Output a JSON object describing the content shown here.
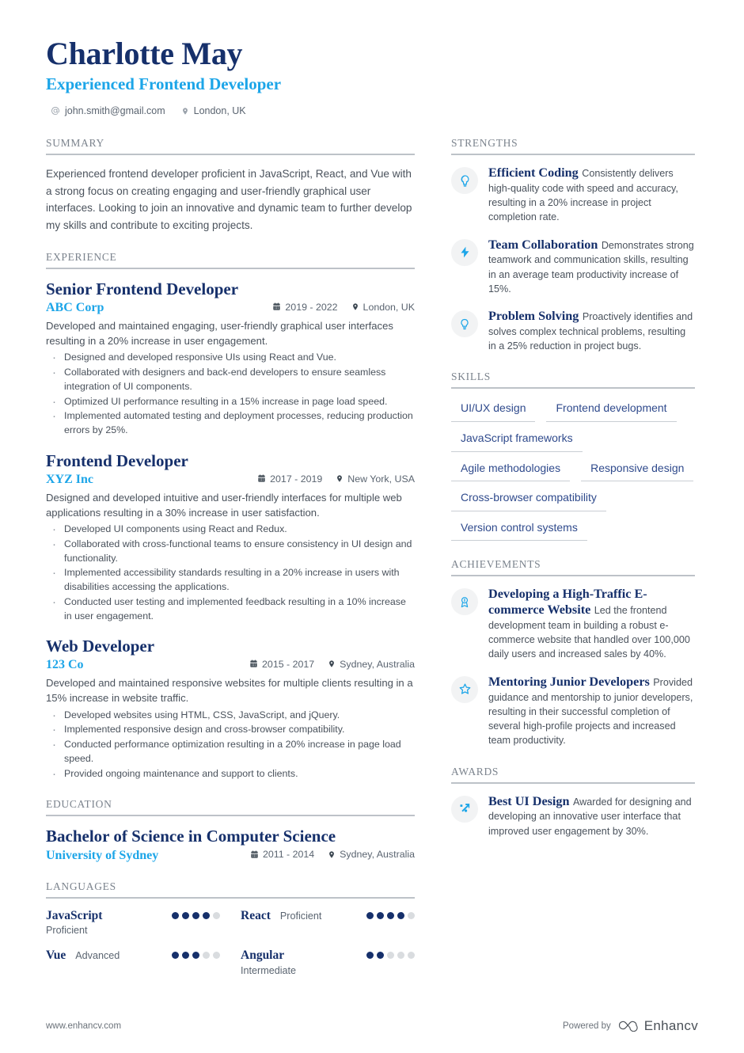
{
  "header": {
    "name": "Charlotte May",
    "title": "Experienced Frontend Developer",
    "email": "john.smith@gmail.com",
    "location": "London, UK",
    "email_icon": "at-icon",
    "location_icon": "map-pin-icon"
  },
  "colors": {
    "navy": "#16306b",
    "cyan": "#1ca5e8",
    "gray_heading": "#7b838d",
    "body": "#4a525c",
    "skill_text": "#2f4a8c"
  },
  "sections": {
    "summary": "SUMMARY",
    "experience": "EXPERIENCE",
    "education": "EDUCATION",
    "languages": "LANGUAGES",
    "strengths": "STRENGTHS",
    "skills": "SKILLS",
    "achievements": "ACHIEVEMENTS",
    "awards": "AWARDS"
  },
  "summary": {
    "text": "Experienced frontend developer proficient in JavaScript, React, and Vue with a strong focus on creating engaging and user-friendly graphical user interfaces. Looking to join an innovative and dynamic team to further develop my skills and contribute to exciting projects."
  },
  "experience": [
    {
      "title": "Senior Frontend Developer",
      "company": "ABC Corp",
      "dates": "2019 - 2022",
      "location": "London, UK",
      "description": "Developed and maintained engaging, user-friendly graphical user interfaces resulting in a 20% increase in user engagement.",
      "bullets": [
        "Designed and developed responsive UIs using React and Vue.",
        "Collaborated with designers and back-end developers to ensure seamless integration of UI components.",
        "Optimized UI performance resulting in a 15% increase in page load speed.",
        "Implemented automated testing and deployment processes, reducing production errors by 25%."
      ]
    },
    {
      "title": "Frontend Developer",
      "company": "XYZ Inc",
      "dates": "2017 - 2019",
      "location": "New York, USA",
      "description": "Designed and developed intuitive and user-friendly interfaces for multiple web applications resulting in a 30% increase in user satisfaction.",
      "bullets": [
        "Developed UI components using React and Redux.",
        "Collaborated with cross-functional teams to ensure consistency in UI design and functionality.",
        "Implemented accessibility standards resulting in a 20% increase in users with disabilities accessing the applications.",
        "Conducted user testing and implemented feedback resulting in a 10% increase in user engagement."
      ]
    },
    {
      "title": "Web Developer",
      "company": "123 Co",
      "dates": "2015 - 2017",
      "location": "Sydney, Australia",
      "description": "Developed and maintained responsive websites for multiple clients resulting in a 15% increase in website traffic.",
      "bullets": [
        "Developed websites using HTML, CSS, JavaScript, and jQuery.",
        "Implemented responsive design and cross-browser compatibility.",
        "Conducted performance optimization resulting in a 20% increase in page load speed.",
        "Provided ongoing maintenance and support to clients."
      ]
    }
  ],
  "education": [
    {
      "degree": "Bachelor of Science in Computer Science",
      "school": "University of Sydney",
      "dates": "2011 - 2014",
      "location": "Sydney, Australia"
    }
  ],
  "languages": [
    {
      "name": "JavaScript",
      "level": "Proficient",
      "rating": 4,
      "max": 5,
      "level_inline": false
    },
    {
      "name": "React",
      "level": "Proficient",
      "rating": 4,
      "max": 5,
      "level_inline": true
    },
    {
      "name": "Vue",
      "level": "Advanced",
      "rating": 3,
      "max": 5,
      "level_inline": true
    },
    {
      "name": "Angular",
      "level": "Intermediate",
      "rating": 2,
      "max": 5,
      "level_inline": false
    }
  ],
  "strengths": [
    {
      "icon": "brain-icon",
      "title": "Efficient Coding",
      "description": "Consistently delivers high-quality code with speed and accuracy, resulting in a 20% increase in project completion rate."
    },
    {
      "icon": "lightning-bolt-icon",
      "title": "Team Collaboration",
      "description": "Demonstrates strong teamwork and communication skills, resulting in an average team productivity increase of 15%."
    },
    {
      "icon": "lightbulb-icon",
      "title": "Problem Solving",
      "description": "Proactively identifies and solves complex technical problems, resulting in a 25% reduction in project bugs."
    }
  ],
  "skills": [
    "UI/UX design",
    "Frontend development",
    "JavaScript frameworks",
    "Agile methodologies",
    "Responsive design",
    "Cross-browser compatibility",
    "Version control systems"
  ],
  "achievements": [
    {
      "icon": "award-ribbon-icon",
      "title": "Developing a High-Traffic E-commerce Website",
      "description": "Led the frontend development team in building a robust e-commerce website that handled over 100,000 daily users and increased sales by 40%."
    },
    {
      "icon": "star-icon",
      "title": "Mentoring Junior Developers",
      "description": "Provided guidance and mentorship to junior developers, resulting in their successful completion of several high-profile projects and increased team productivity."
    }
  ],
  "awards": [
    {
      "icon": "trending-arrow-icon",
      "title": "Best UI Design",
      "description": "Awarded for designing and developing an innovative user interface that improved user engagement by 30%."
    }
  ],
  "footer": {
    "website": "www.enhancv.com",
    "powered_by": "Powered by",
    "brand": "Enhancv"
  }
}
